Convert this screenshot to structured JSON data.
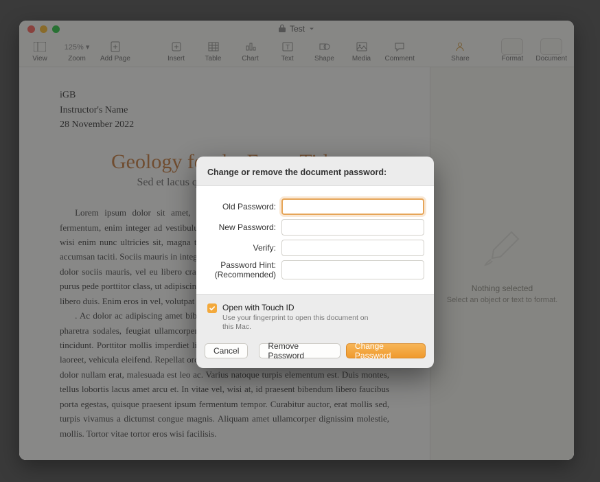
{
  "title": "Test",
  "toolbar": {
    "left": [
      {
        "name": "view-button",
        "label": "View",
        "icon": "view"
      },
      {
        "name": "zoom-button",
        "label": "Zoom",
        "icon": "zoom"
      },
      {
        "name": "add-page-button",
        "label": "Add Page",
        "icon": "add"
      }
    ],
    "center": [
      {
        "name": "insert-button",
        "label": "Insert",
        "icon": "insert"
      },
      {
        "name": "table-button",
        "label": "Table",
        "icon": "table"
      },
      {
        "name": "chart-button",
        "label": "Chart",
        "icon": "chart"
      },
      {
        "name": "text-button",
        "label": "Text",
        "icon": "text"
      },
      {
        "name": "shape-button",
        "label": "Shape",
        "icon": "shape"
      },
      {
        "name": "media-button",
        "label": "Media",
        "icon": "media"
      },
      {
        "name": "comment-button",
        "label": "Comment",
        "icon": "comment"
      }
    ],
    "right": [
      {
        "name": "collaborate-button",
        "label": "Share",
        "icon": "share"
      }
    ],
    "segLabels": {
      "format": "Format",
      "document": "Document"
    }
  },
  "doc": {
    "meta1": "iGB",
    "meta2": "Instructor's Name",
    "meta3": "28 November 2022",
    "title": "Geology for the Essay Title",
    "subtitle": "Sed et lacus quis enim mattis nonummy",
    "para1": "Lorem ipsum dolor sit amet, ligula suspendisse nulla pretium, rhoncus tempor fermentum, enim integer ad vestibulum volutpat. Nisl rhoncus turpis est, vel elit, congue wisi enim nunc ultricies sit, magna tincidunt. Maecenas aliquam maecenas ligula nostra, accumsan taciti. Sociis mauris in integer, a dolor netus non dui aliquet, sagittis felis sodales, dolor sociis mauris, vel eu libero cras. Faucibus at. Arcu habitasse elementum est, ipsum purus pede porttitor class, ut adipiscing, aliquet sed auctor, imperdiet arcu per diam dapibus libero duis. Enim eros in vel, volutpat nec pellentesque leo, temporibus scelerisque nec.",
    "para2": ". Ac dolor ac adipiscing amet bibendum nullam, lacus molestie ut libero nec, diam et, pharetra sodales, feugiat ullamcorper id tempor id vitae. Mauris pretium aliquet, lectus tincidunt. Porttitor mollis imperdiet libero senectus pulvinar. Etiam molestie mauris ligula laoreet, vehicula eleifend. Repellat orci erat et, sem cum, ultricies sollicitudin amet eleifend dolor nullam erat, malesuada est leo ac. Varius natoque turpis elementum est. Duis montes, tellus lobortis lacus amet arcu et. In vitae vel, wisi at, id praesent bibendum libero faucibus porta egestas, quisque praesent ipsum fermentum tempor. Curabitur auctor, erat mollis sed, turpis vivamus a dictumst congue magnis. Aliquam amet ullamcorper dignissim molestie, mollis. Tortor vitae tortor eros wisi facilisis."
  },
  "inspector": {
    "heading": "Nothing selected",
    "sub": "Select an object or text to format."
  },
  "dialog": {
    "heading": "Change or remove the document password:",
    "oldLabel": "Old Password:",
    "newLabel": "New Password:",
    "verifyLabel": "Verify:",
    "hintLabel1": "Password Hint:",
    "hintLabel2": "(Recommended)",
    "touchLabel": "Open with Touch ID",
    "touchSub": "Use your fingerprint to open this document on this Mac.",
    "cancel": "Cancel",
    "remove": "Remove Password",
    "change": "Change Password",
    "values": {
      "old": "",
      "new": "",
      "verify": "",
      "hint": ""
    }
  }
}
